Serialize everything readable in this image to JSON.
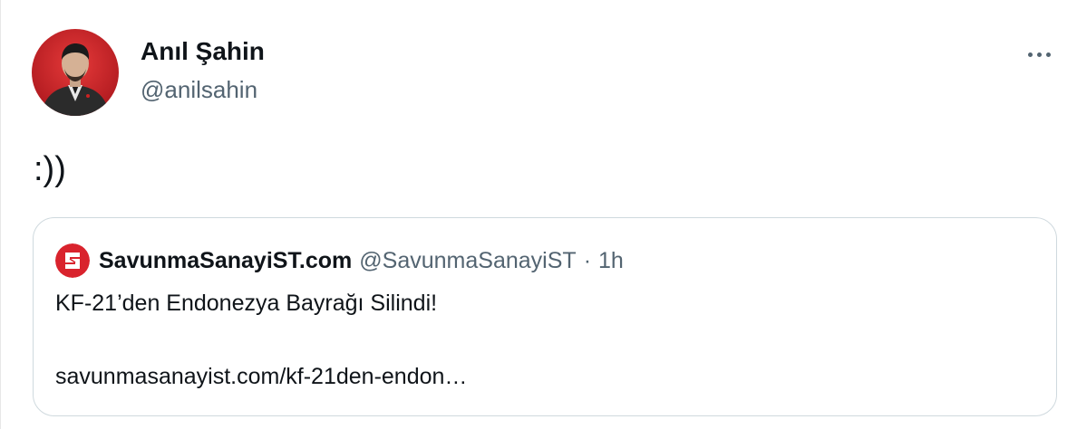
{
  "author": {
    "name": "Anıl Şahin",
    "handle": "@anilsahin",
    "avatar_icon": "user-avatar-icon"
  },
  "more_icon": "more-horizontal-icon",
  "tweet": {
    "text": ":))"
  },
  "quoted_tweet": {
    "avatar_icon": "savunmasanayist-logo-icon",
    "name": "SavunmaSanayiST.com",
    "handle": "@SavunmaSanayiST",
    "separator": "·",
    "time": "1h",
    "text": "KF-21’den Endonezya Bayrağı Silindi!",
    "link": "savunmasanayist.com/kf-21den-endon…"
  },
  "colors": {
    "text_primary": "#0f1419",
    "text_secondary": "#536471",
    "border": "#cfd9de",
    "brand_red": "#d9232d"
  }
}
